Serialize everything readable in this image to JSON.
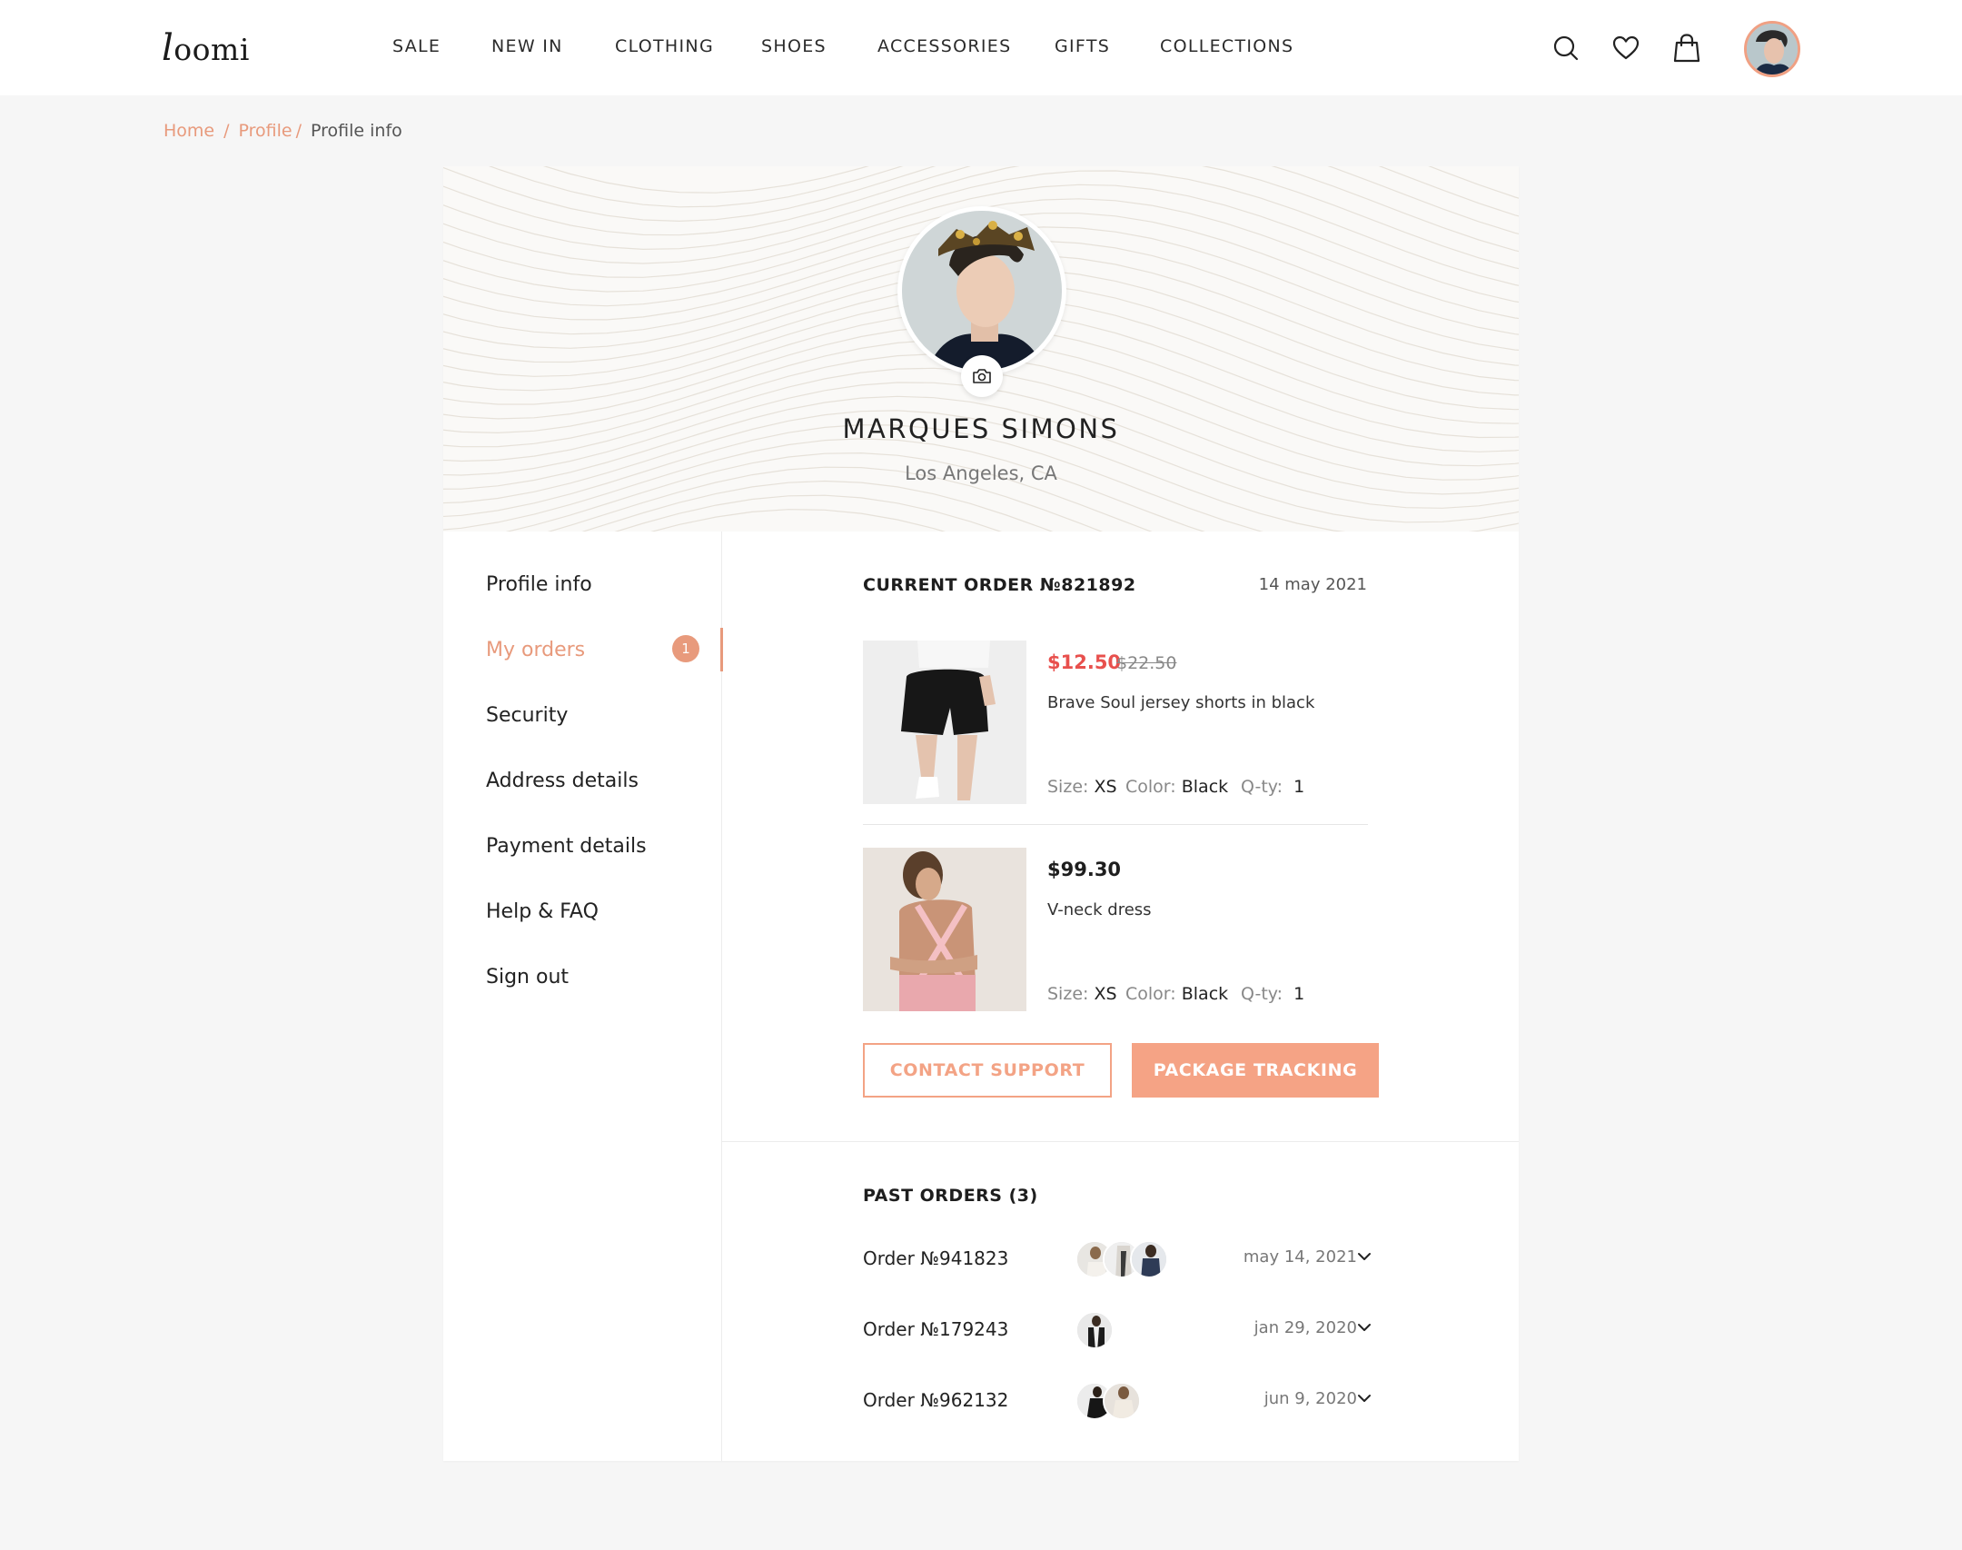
{
  "brand": {
    "logo": "loomi"
  },
  "nav": [
    "SALE",
    "NEW IN",
    "CLOTHING",
    "SHOES",
    "ACCESSORIES",
    "GIFTS",
    "COLLECTIONS"
  ],
  "header_icons": [
    "search-icon",
    "heart-icon",
    "shopping-bag-icon",
    "user-avatar"
  ],
  "breadcrumb": {
    "home": "Home",
    "profile": "Profile",
    "current": "Profile info",
    "sep": "/"
  },
  "profile": {
    "name": "MARQUES SIMONS",
    "location": "Los Angeles, CA"
  },
  "sidebar": {
    "items": [
      {
        "label": "Profile info"
      },
      {
        "label": "My orders",
        "badge": "1",
        "active": true
      },
      {
        "label": "Security"
      },
      {
        "label": "Address details"
      },
      {
        "label": "Payment details"
      },
      {
        "label": "Help & FAQ"
      },
      {
        "label": "Sign out"
      }
    ]
  },
  "current_order": {
    "title": "CURRENT ORDER №821892",
    "date": "14 may 2021",
    "items": [
      {
        "price": "$12.50",
        "old_price": "$22.50",
        "name": "Brave Soul jersey shorts in black",
        "size_label": "Size:",
        "size": "XS",
        "color_label": "Color:",
        "color": "Black",
        "qty_label": "Q-ty:",
        "qty": "1"
      },
      {
        "price": "$99.30",
        "name": "V-neck dress",
        "size_label": "Size:",
        "size": "XS",
        "color_label": "Color:",
        "color": "Black",
        "qty_label": "Q-ty:",
        "qty": "1"
      }
    ],
    "buttons": {
      "support": "CONTACT SUPPORT",
      "tracking": "PACKAGE TRACKING"
    }
  },
  "past_orders": {
    "title": "PAST ORDERS (3)",
    "orders": [
      {
        "label": "Order №941823",
        "date": "may 14, 2021"
      },
      {
        "label": "Order №179243",
        "date": "jan 29, 2020"
      },
      {
        "label": "Order №962132",
        "date": "jun 9, 2020"
      }
    ]
  },
  "colors": {
    "accent": "#e89a7c",
    "button_fill": "#f5a385",
    "sale_price": "#e8504d",
    "background": "#f6f6f6"
  }
}
